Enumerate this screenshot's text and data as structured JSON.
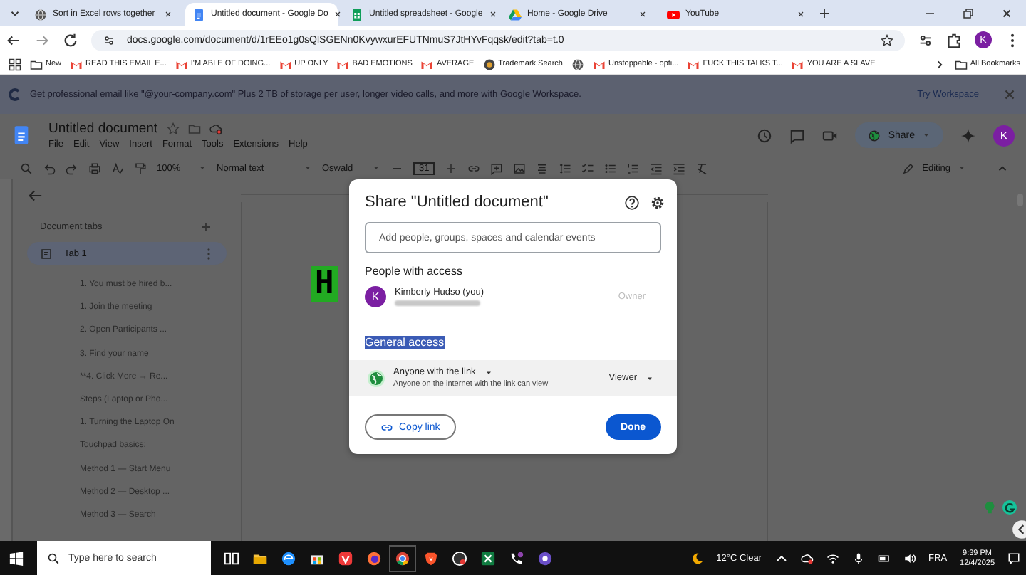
{
  "browser": {
    "tabs": [
      {
        "title": "Sort in Excel rows together",
        "kind": "globe",
        "selected": false
      },
      {
        "title": "Untitled document - Google Do",
        "kind": "docs",
        "selected": true
      },
      {
        "title": "Untitled spreadsheet - Google",
        "kind": "sheets",
        "selected": false
      },
      {
        "title": "Home - Google Drive",
        "kind": "drive",
        "selected": false
      },
      {
        "title": "YouTube",
        "kind": "youtube",
        "selected": false
      }
    ],
    "address": "docs.google.com/document/d/1rEEo1g0sQlSGENn0KvywxurEFUTNmuS7JtHYvFqqsk/edit?tab=t.0",
    "bookmarks": [
      {
        "title": "New",
        "kind": "folder"
      },
      {
        "title": "READ THIS EMAIL E...",
        "kind": "gmail"
      },
      {
        "title": "I'M ABLE OF DOING...",
        "kind": "gmail"
      },
      {
        "title": "UP ONLY",
        "kind": "gmail"
      },
      {
        "title": "BAD EMOTIONS",
        "kind": "gmail"
      },
      {
        "title": "AVERAGE",
        "kind": "gmail"
      },
      {
        "title": "Trademark Search",
        "kind": "seal"
      },
      {
        "kind": "globe"
      },
      {
        "title": "Unstoppable - opti...",
        "kind": "gmail"
      },
      {
        "title": "FUCK THIS TALKS T...",
        "kind": "gmail"
      },
      {
        "title": "YOU ARE A SLAVE",
        "kind": "gmail"
      }
    ],
    "all_bookmarks": "All Bookmarks",
    "profile": "K"
  },
  "banner": {
    "text": "Get professional email like \"@your-company.com\"  Plus 2 TB of storage per user, longer video calls, and more with Google Workspace.",
    "action": "Try Workspace"
  },
  "docs": {
    "title": "Untitled document",
    "menus": [
      "File",
      "Edit",
      "View",
      "Insert",
      "Format",
      "Tools",
      "Extensions",
      "Help"
    ],
    "share": "Share",
    "profile": "K",
    "toolbar": {
      "zoom": "100%",
      "style": "Normal text",
      "font": "Oswald",
      "size": "31",
      "mode": "Editing"
    }
  },
  "sidebar": {
    "heading": "Document tabs",
    "tab": {
      "label": "Tab 1",
      "selected": true,
      "children": [
        {
          "label": "1. You must be hired b..."
        },
        {
          "label": "1. Join the meeting"
        },
        {
          "label": "2. Open Participants ..."
        },
        {
          "label": "3. Find your name"
        },
        {
          "label": "**4. Click More → Re..."
        },
        {
          "label": "Steps (Laptop or Pho..."
        },
        {
          "label": "1. Turning the Laptop On"
        },
        {
          "label": "Touchpad basics:"
        },
        {
          "label": "Method 1 — Start Menu"
        },
        {
          "label": "Method 2 — Desktop ..."
        },
        {
          "label": "Method 3 — Search"
        }
      ]
    }
  },
  "page": {
    "heading": "H"
  },
  "dialog": {
    "title": "Share \"Untitled document\"",
    "placeholder": "Add people, groups, spaces and calendar events",
    "people_heading": "People with access",
    "person": {
      "initial": "K",
      "name": "Kimberly Hudso (you)",
      "role": "Owner",
      "role_disabled": true
    },
    "general_heading": "General access",
    "general_heading_selected": true,
    "access": {
      "scope": "Anyone with the link",
      "description": "Anyone on the internet with the link can view",
      "role": "Viewer"
    },
    "buttons": [
      "Copy link",
      "Done"
    ]
  },
  "taskbar": {
    "search": "Type here to search",
    "weather": "12°C  Clear",
    "language": "FRA",
    "time": "9:39 PM",
    "date": "12/4/2025"
  }
}
